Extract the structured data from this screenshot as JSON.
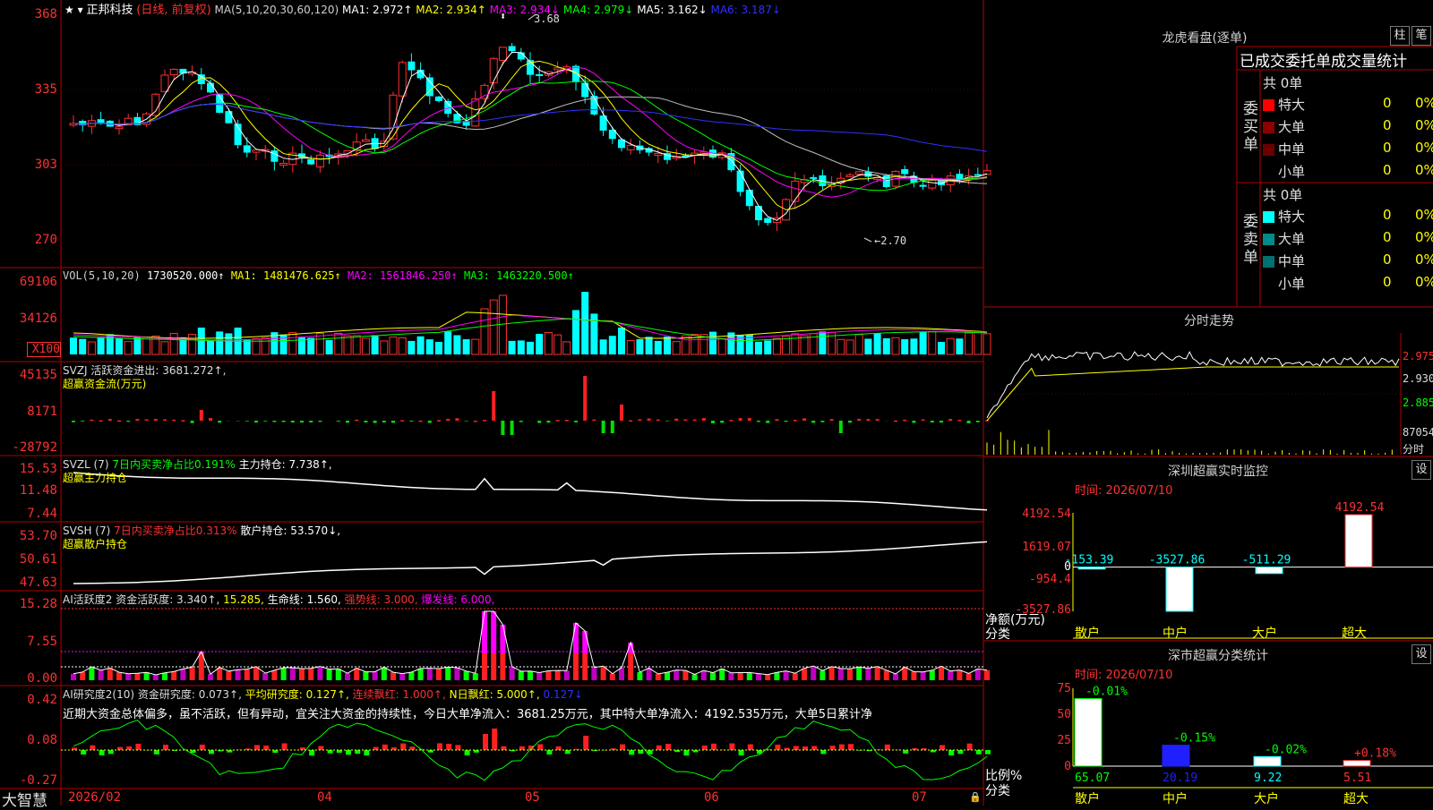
{
  "header": {
    "stock": "正邦科技",
    "mode": "(日线, 前复权)",
    "ma_params": "MA(5,10,20,30,60,120)",
    "ma1": "MA1: 2.972↑",
    "ma2": "MA2: 2.934↑",
    "ma3": "MA3: 2.934↓",
    "ma4": "MA4: 2.979↓",
    "ma5": "MA5: 3.162↓",
    "ma6": "MA6: 3.187↓",
    "high_mark": "3.68",
    "low_mark": "←2.70"
  },
  "price_axis": [
    "368",
    "335",
    "303",
    "270"
  ],
  "vol": {
    "params": "VOL(5,10,20)",
    "value": "1730520.000↑",
    "ma1": "MA1: 1481476.625↑",
    "ma2": "MA2: 1561846.250↑",
    "ma3": "MA3: 1463220.500↑",
    "axis": [
      "69106",
      "34126",
      "X100"
    ]
  },
  "svzj": {
    "title": "SVZJ  活跃资金进出: 3681.272↑,",
    "subtitle": "超赢资金流(万元)",
    "axis": [
      "45135",
      "8171",
      "-28792"
    ]
  },
  "svzl": {
    "title": "SVZL (7)",
    "ratio": "7日内买卖净占比0.191%",
    "hold": "主力持仓: 7.738↑,",
    "subtitle": "超赢主力持仓",
    "axis": [
      "15.53",
      "11.48",
      "7.44"
    ]
  },
  "svsh": {
    "title": "SVSH (7)",
    "ratio": "7日内买卖净占比0.313%",
    "hold": "散户持仓: 53.570↓,",
    "subtitle": "超赢散户持仓",
    "axis": [
      "53.70",
      "50.61",
      "47.63"
    ]
  },
  "ai1": {
    "title": "AI活跃度2 资金活跃度: 3.340↑,",
    "v2": "15.285,",
    "life": "生命线: 1.560,",
    "strong": "强势线: 3.000,",
    "burst": "爆发线: 6.000,",
    "axis": [
      "15.28",
      "7.55",
      "0.00"
    ]
  },
  "ai2": {
    "title": "AI研究度2(10) 资金研究度: 0.073↑,",
    "avg": "平均研究度: 0.127↑,",
    "cont": "连续飘红: 1.000↑,",
    "nday": "N日飘红: 5.000↑,",
    "last": "0.127↓",
    "comment": "近期大资金总体偏多，虽不活跃，但有异动，宜关注大资金的持续性，今日大单净流入：3681.25万元，其中特大单净流入：4192.535万元，大单5日累计净",
    "axis": [
      "0.42",
      "0.08",
      "-0.27"
    ]
  },
  "xaxis": {
    "brand": "大智慧",
    "labels": [
      "2026/02",
      "04",
      "05",
      "06",
      "07"
    ]
  },
  "side": {
    "lhb_title": "龙虎看盘(逐单)",
    "btn_bar": "柱",
    "btn_pen": "笔",
    "tabs_title": "已成交委托单成交量统计",
    "buy_label": "委买单",
    "sell_label": "委卖单",
    "buy_total": "共 0单",
    "sell_total": "共 0单",
    "buy_rows": [
      {
        "name": "特大",
        "count": "0",
        "pct": "0%",
        "color": "#ff0000"
      },
      {
        "name": "大单",
        "count": "0",
        "pct": "0%",
        "color": "#8b0000"
      },
      {
        "name": "中单",
        "count": "0",
        "pct": "0%",
        "color": "#6b0000"
      },
      {
        "name": "小单",
        "count": "0",
        "pct": "0%",
        "color": "#000000"
      }
    ],
    "sell_rows": [
      {
        "name": "特大",
        "count": "0",
        "pct": "0%",
        "color": "#00ffff"
      },
      {
        "name": "大单",
        "count": "0",
        "pct": "0%",
        "color": "#008b8b"
      },
      {
        "name": "中单",
        "count": "0",
        "pct": "0%",
        "color": "#007070"
      },
      {
        "name": "小单",
        "count": "0",
        "pct": "0%",
        "color": "#000000"
      }
    ],
    "intraday_title": "分时走势",
    "intraday_axis": [
      "2.975",
      "2.930",
      "2.885",
      "87054",
      "分时"
    ],
    "monitor_title": "深圳超赢实时监控",
    "monitor_btn": "设",
    "monitor_time": "时间: 2026/07/10",
    "monitor_axis": [
      "4192.54",
      "1619.07",
      "0",
      "-954.4",
      "-3527.86"
    ],
    "monitor_ylabel": "净额(万元)",
    "monitor_xlabel": "分类",
    "classify_title": "深市超赢分类统计",
    "classify_btn": "设",
    "classify_time": "时间: 2026/07/10",
    "classify_axis": [
      "75",
      "50",
      "25",
      "0"
    ],
    "classify_ylabel": "比例%",
    "classify_xlabel": "分类"
  },
  "chart_data": [
    {
      "type": "bar",
      "title": "深圳超赢实时监控",
      "categories": [
        "散户",
        "中户",
        "大户",
        "超大"
      ],
      "values": [
        -153.39,
        -3527.86,
        -511.29,
        4192.54
      ],
      "ylim": [
        -3527.86,
        4192.54
      ]
    },
    {
      "type": "bar",
      "title": "深市超赢分类统计",
      "categories": [
        "散户",
        "中户",
        "大户",
        "超大"
      ],
      "values": [
        65.07,
        20.19,
        9.22,
        5.51
      ],
      "changes": [
        "-0.01%",
        "-0.15%",
        "-0.02%",
        "+0.18%"
      ],
      "ylim": [
        0,
        75
      ]
    }
  ]
}
